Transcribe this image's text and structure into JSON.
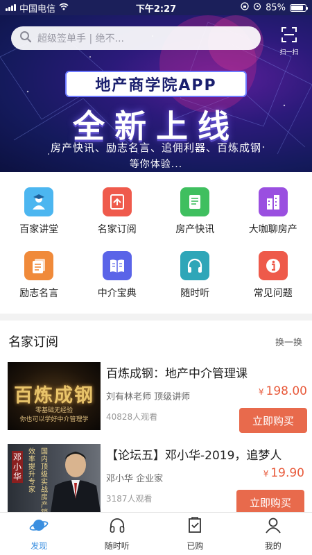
{
  "status_bar": {
    "carrier": "中国电信",
    "time": "下午2:27",
    "battery": "85%",
    "battery_level": 0.85
  },
  "banner": {
    "search_placeholder": "超级签单手 | 绝不...",
    "scan_label": "扫一扫",
    "brand": "地产商学院APP",
    "headline": "全新上线",
    "subline": "房产快讯、励志名言、追佣利器、百炼成钢",
    "subline2": "等你体验...",
    "carousel_pages": 3,
    "carousel_active": 0
  },
  "categories": [
    {
      "label": "百家讲堂",
      "icon": "teacher-icon",
      "color": "#4cb6f0"
    },
    {
      "label": "名家订阅",
      "icon": "subscribe-icon",
      "color": "#ef5a4c"
    },
    {
      "label": "房产快讯",
      "icon": "news-icon",
      "color": "#3fbf5f"
    },
    {
      "label": "大咖聊房产",
      "icon": "building-icon",
      "color": "#9a4fe0"
    },
    {
      "label": "励志名言",
      "icon": "quotes-icon",
      "color": "#f08a3a"
    },
    {
      "label": "中介宝典",
      "icon": "book-icon",
      "color": "#5a64e8"
    },
    {
      "label": "随时听",
      "icon": "headphones-icon",
      "color": "#2fa6b8"
    },
    {
      "label": "常见问题",
      "icon": "info-icon",
      "color": "#ee5a4a"
    }
  ],
  "section": {
    "title": "名家订阅",
    "more": "换一换"
  },
  "courses": [
    {
      "title": "百炼成钢：地产中介管理课",
      "teacher": "刘有林老师 顶级讲师",
      "viewers": "40828人观看",
      "currency": "¥",
      "price": "198.00",
      "buy": "立即购买",
      "thumb_title": "百炼成钢",
      "thumb_sub1": "零基础无经验",
      "thumb_sub2": "你也可以学好中介管理学"
    },
    {
      "title": "【论坛五】邓小华-2019，追梦人",
      "teacher": "邓小华 企业家",
      "viewers": "3187人观看",
      "currency": "¥",
      "price": "19.90",
      "buy": "立即购买",
      "thumb_name": "邓小华",
      "thumb_lines": [
        "效率提升专家",
        "国内顶级实战房产销售"
      ]
    }
  ],
  "tabs": [
    {
      "label": "发现",
      "icon": "planet-icon",
      "active": true
    },
    {
      "label": "随时听",
      "icon": "headphones-icon",
      "active": false
    },
    {
      "label": "已购",
      "icon": "purchased-icon",
      "active": false
    },
    {
      "label": "我的",
      "icon": "user-icon",
      "active": false
    }
  ],
  "colors": {
    "accent": "#3a8fe0",
    "price": "#e85a3b",
    "buy_button": "#e86a4c"
  }
}
